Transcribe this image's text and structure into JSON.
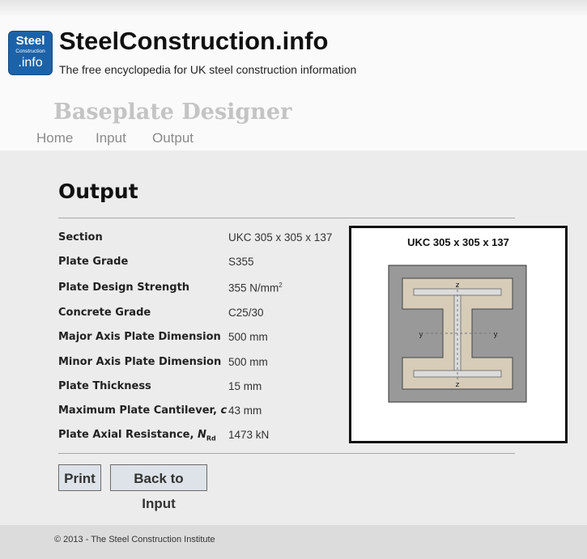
{
  "header": {
    "logo": {
      "line1": "Steel",
      "line2": "Construction",
      "line3": ".info"
    },
    "site_title": "SteelConstruction.info",
    "tagline": "The free encyclopedia for UK steel construction information",
    "app_title": "Baseplate Designer"
  },
  "nav": [
    {
      "label": "Home"
    },
    {
      "label": "Input"
    },
    {
      "label": "Output"
    }
  ],
  "page": {
    "heading": "Output"
  },
  "results": [
    {
      "label": "Section",
      "value": "UKC 305 x 305 x 137"
    },
    {
      "label": "Plate Grade",
      "value": "S355"
    },
    {
      "label": "Plate Design Strength",
      "value": "355 N/mm",
      "value_sup": "2"
    },
    {
      "label": "Concrete Grade",
      "value": "C25/30"
    },
    {
      "label": "Major Axis Plate Dimension",
      "value": "500 mm"
    },
    {
      "label": "Minor Axis Plate Dimension",
      "value": "500 mm"
    },
    {
      "label": "Plate Thickness",
      "value": "15 mm"
    },
    {
      "label": "Maximum Plate Cantilever, ",
      "label_italic": "c",
      "value": "43 mm"
    },
    {
      "label": "Plate Axial Resistance, ",
      "label_italic": "N",
      "label_sub": "Rd",
      "value": "1473 kN"
    }
  ],
  "figure": {
    "title": "UKC 305 x 305 x 137",
    "axis_labels": {
      "top": "z",
      "bottom": "z",
      "left": "y",
      "right": "y"
    },
    "colors": {
      "plate": "#999999",
      "effective_area": "#d6ccb8",
      "section": "#dcdcdc",
      "outline": "#333333"
    }
  },
  "buttons": {
    "print": "Print",
    "back": "Back to Input"
  },
  "footer": {
    "copyright": "© 2013 - The Steel Construction Institute"
  }
}
